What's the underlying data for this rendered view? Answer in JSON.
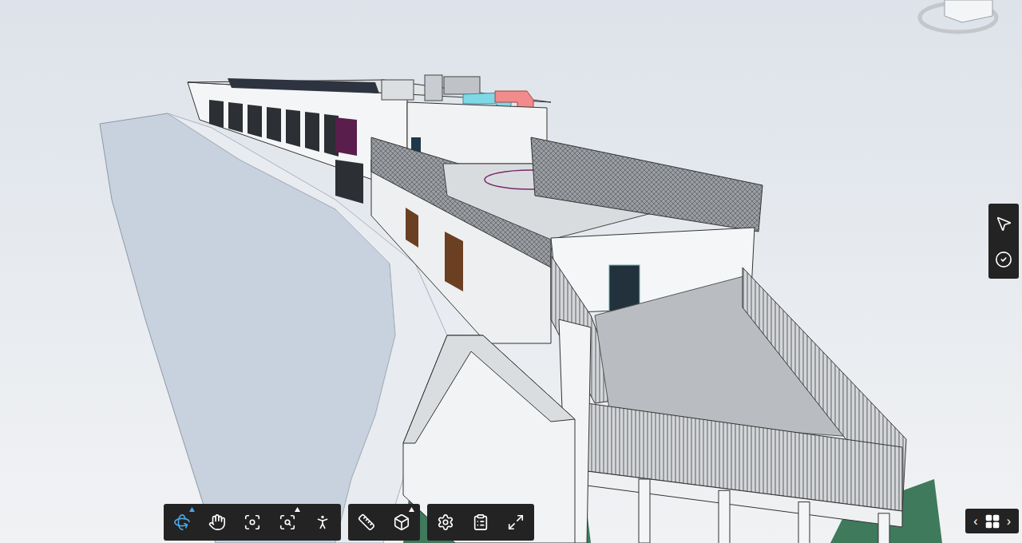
{
  "toolbar": {
    "groups": [
      {
        "tools": [
          {
            "kind": "orbit",
            "selected": true,
            "has_menu": true
          },
          {
            "kind": "pan",
            "selected": false,
            "has_menu": false
          },
          {
            "kind": "fit",
            "selected": false,
            "has_menu": false
          },
          {
            "kind": "zoom-window",
            "selected": false,
            "has_menu": true
          },
          {
            "kind": "first-person",
            "selected": false,
            "has_menu": false
          }
        ]
      },
      {
        "tools": [
          {
            "kind": "measure",
            "selected": false,
            "has_menu": false
          },
          {
            "kind": "section",
            "selected": false,
            "has_menu": true
          }
        ]
      },
      {
        "tools": [
          {
            "kind": "settings",
            "selected": false,
            "has_menu": false
          },
          {
            "kind": "properties",
            "selected": false,
            "has_menu": false
          },
          {
            "kind": "fullscreen",
            "selected": false,
            "has_menu": false
          }
        ]
      }
    ]
  },
  "side_tools": [
    {
      "kind": "select",
      "selected": false
    },
    {
      "kind": "markup",
      "selected": false
    }
  ],
  "view_nav": {
    "prev": "‹",
    "next": "›"
  }
}
